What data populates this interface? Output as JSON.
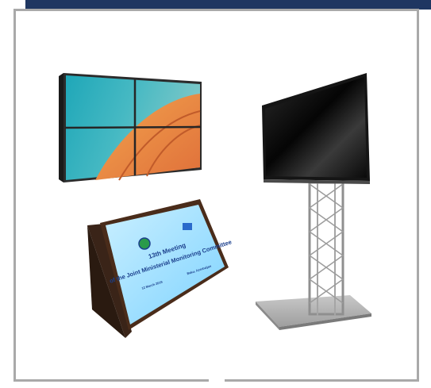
{
  "colors": {
    "band": "#1f3661",
    "frame": "#a9a9a9",
    "screen_text": "#1b3f8c"
  },
  "podium": {
    "screen_title_line1": "13th Meeting",
    "screen_title_line2": "of the Joint Ministerial Monitoring Committee",
    "screen_date": "12 March 2019",
    "screen_place": "Baku, Azerbaijan"
  },
  "products": [
    {
      "name": "video-wall"
    },
    {
      "name": "podium-display"
    },
    {
      "name": "tv-on-truss-stand"
    }
  ]
}
